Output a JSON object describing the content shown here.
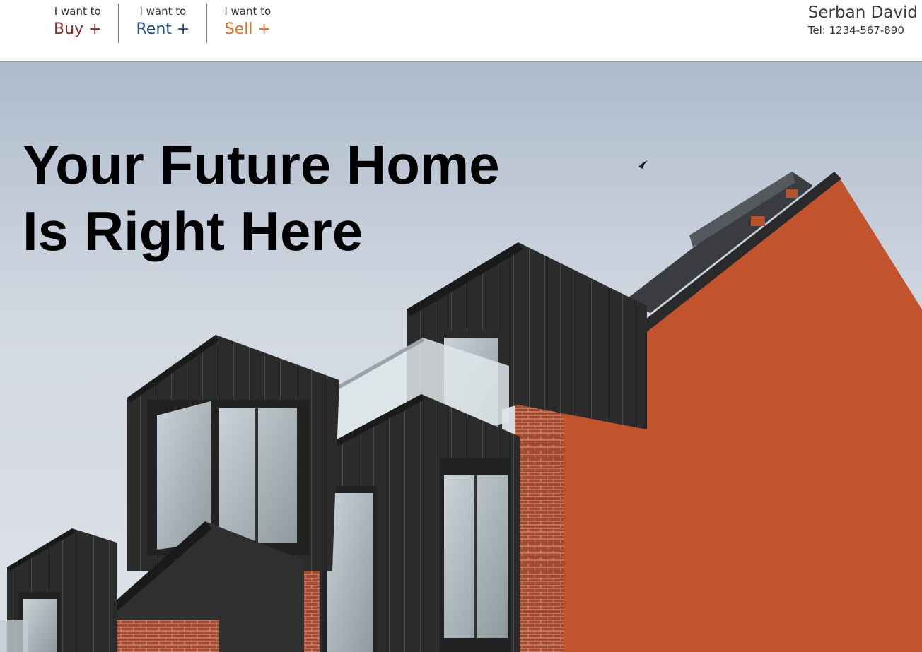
{
  "nav": {
    "items": [
      {
        "pre": "I want to",
        "label": "Buy +"
      },
      {
        "pre": "I want to",
        "label": "Rent +"
      },
      {
        "pre": "I want to",
        "label": "Sell +"
      }
    ]
  },
  "agent": {
    "name": "Serban David",
    "tel": "Tel: 1234-567-890"
  },
  "hero": {
    "line1": "Your Future Home",
    "line2": "Is Right Here"
  },
  "colors": {
    "buy": "#8b2a2a",
    "rent": "#1f4f86",
    "sell": "#ea6a1f"
  }
}
